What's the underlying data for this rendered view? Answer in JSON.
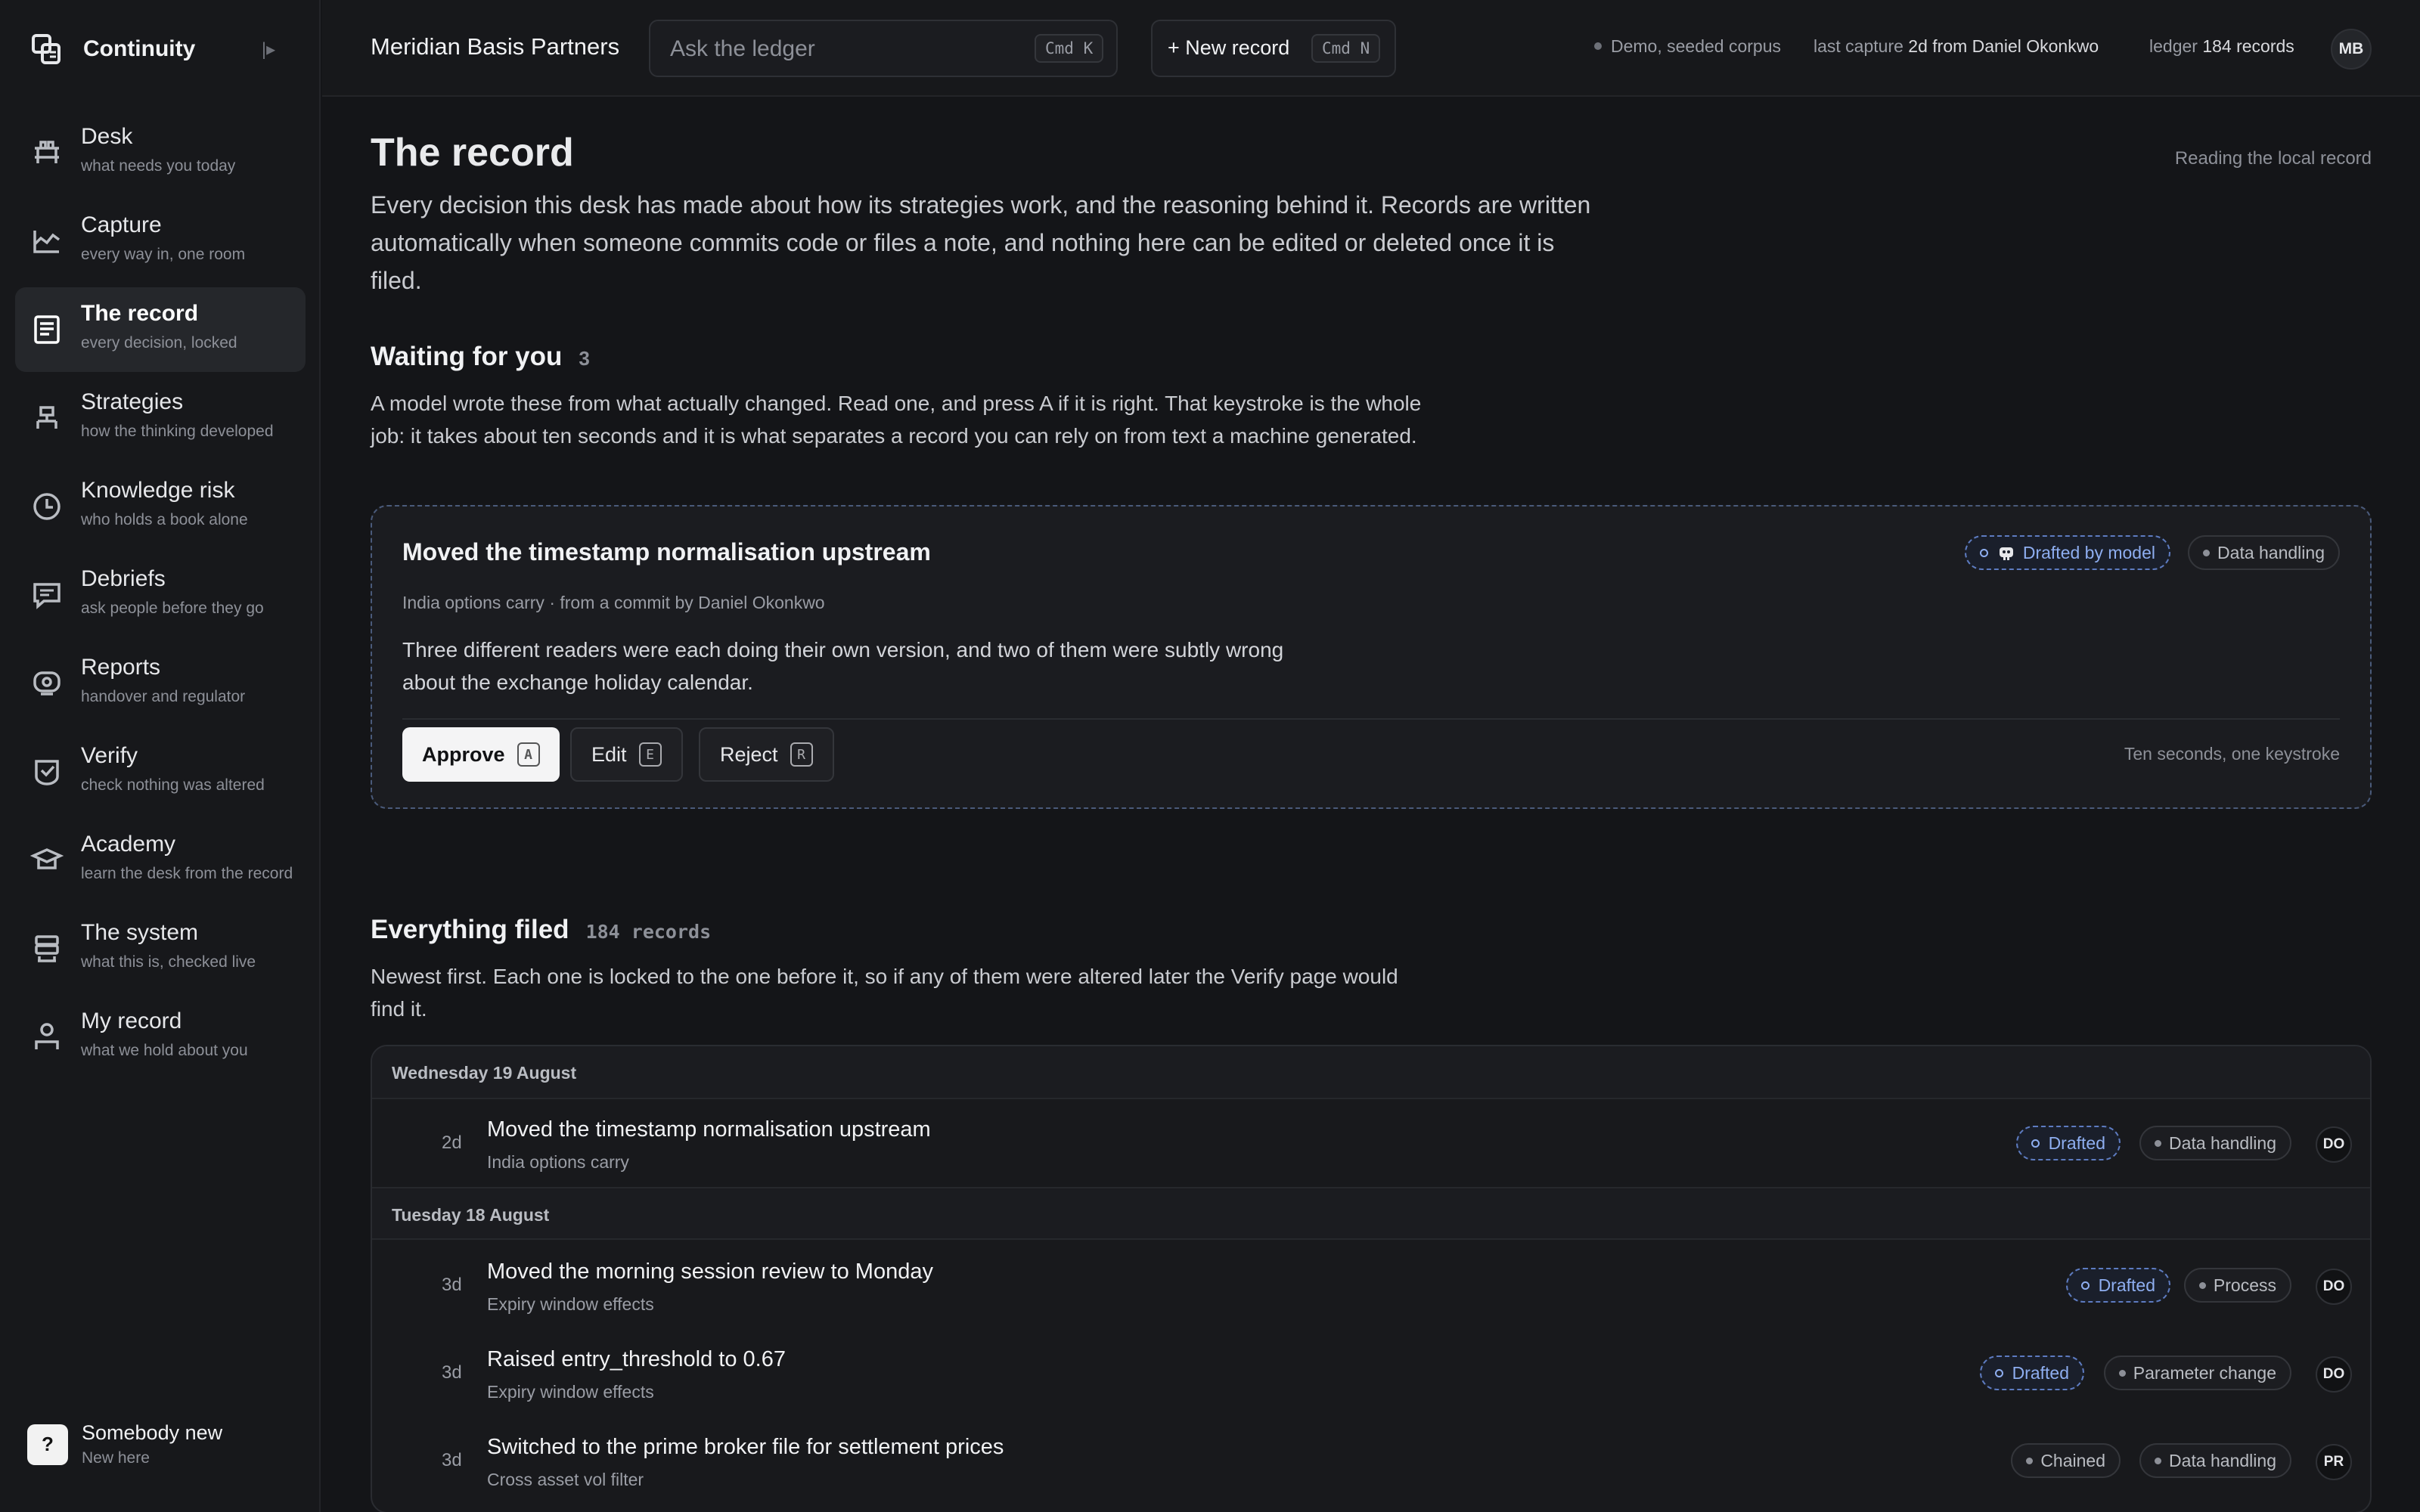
{
  "app": {
    "name": "Continuity",
    "collapse_icon": "|▸"
  },
  "sidebar": {
    "items": [
      {
        "label": "Desk",
        "sub": "what needs you today",
        "icon": "desk-icon"
      },
      {
        "label": "Capture",
        "sub": "every way in, one room",
        "icon": "capture-icon"
      },
      {
        "label": "The record",
        "sub": "every decision, locked",
        "icon": "record-icon",
        "active": true
      },
      {
        "label": "Strategies",
        "sub": "how the thinking developed",
        "icon": "strategies-icon"
      },
      {
        "label": "Knowledge risk",
        "sub": "who holds a book alone",
        "icon": "clock-icon"
      },
      {
        "label": "Debriefs",
        "sub": "ask people before they go",
        "icon": "chat-icon"
      },
      {
        "label": "Reports",
        "sub": "handover and regulator",
        "icon": "reports-icon"
      },
      {
        "label": "Verify",
        "sub": "check nothing was altered",
        "icon": "verify-icon"
      },
      {
        "label": "Academy",
        "sub": "learn the desk from the record",
        "icon": "academy-icon"
      },
      {
        "label": "The system",
        "sub": "what this is, checked live",
        "icon": "system-icon"
      },
      {
        "label": "My record",
        "sub": "what we hold about you",
        "icon": "person-icon"
      }
    ],
    "user": {
      "initial": "?",
      "name": "Somebody new",
      "sub": "New here"
    }
  },
  "topbar": {
    "firm": "Meridian Basis Partners",
    "search_placeholder": "Ask the ledger",
    "search_kbd": "Cmd K",
    "new_record_label": "+  New record",
    "new_record_kbd": "Cmd N",
    "corpus": "Demo, seeded corpus",
    "last_capture_label": "last capture",
    "last_capture_value": "2d from Daniel Okonkwo",
    "ledger_label": "ledger",
    "ledger_value": "184 records",
    "user_initials": "MB"
  },
  "page": {
    "title": "The record",
    "reading": "Reading the local record",
    "intro": "Every decision this desk has made about how its strategies work, and the reasoning behind it. Records are written automatically when someone commits code or files a note, and nothing here can be edited or deleted once it is filed."
  },
  "waiting": {
    "title": "Waiting for you",
    "count": "3",
    "desc": "A model wrote these from what actually changed. Read one, and press A if it is right. That keystroke is the whole job: it takes about ten seconds and it is what separates a record you can rely on from text a machine generated.",
    "card": {
      "title": "Moved the timestamp normalisation upstream",
      "meta": "India options carry · from a commit by Daniel Okonkwo",
      "body": "Three different readers were each doing their own version, and two of them were subtly wrong about the exchange holiday calendar.",
      "badge_drafted": "Drafted by model",
      "badge_kind": "Data handling",
      "approve": "Approve",
      "approve_key": "A",
      "edit": "Edit",
      "edit_key": "E",
      "reject": "Reject",
      "reject_key": "R",
      "hint": "Ten seconds, one keystroke"
    }
  },
  "filed": {
    "title": "Everything filed",
    "count": "184 records",
    "desc": "Newest first. Each one is locked to the one before it, so if any of them were altered later the Verify page would find it.",
    "groups": [
      {
        "day": "Wednesday 19 August",
        "rows": [
          {
            "age": "2d",
            "title": "Moved the timestamp normalisation upstream",
            "sub": "India options carry",
            "status": "Drafted",
            "kind": "Data handling",
            "who": "DO"
          }
        ]
      },
      {
        "day": "Tuesday 18 August",
        "rows": [
          {
            "age": "3d",
            "title": "Moved the morning session review to Monday",
            "sub": "Expiry window effects",
            "status": "Drafted",
            "kind": "Process",
            "who": "DO"
          },
          {
            "age": "3d",
            "title": "Raised entry_threshold to 0.67",
            "sub": "Expiry window effects",
            "status": "Drafted",
            "kind": "Parameter change",
            "who": "DO"
          },
          {
            "age": "3d",
            "title": "Switched to the prime broker file for settlement prices",
            "sub": "Cross asset vol filter",
            "status": "Chained",
            "kind": "Data handling",
            "who": "PR"
          }
        ]
      }
    ]
  }
}
